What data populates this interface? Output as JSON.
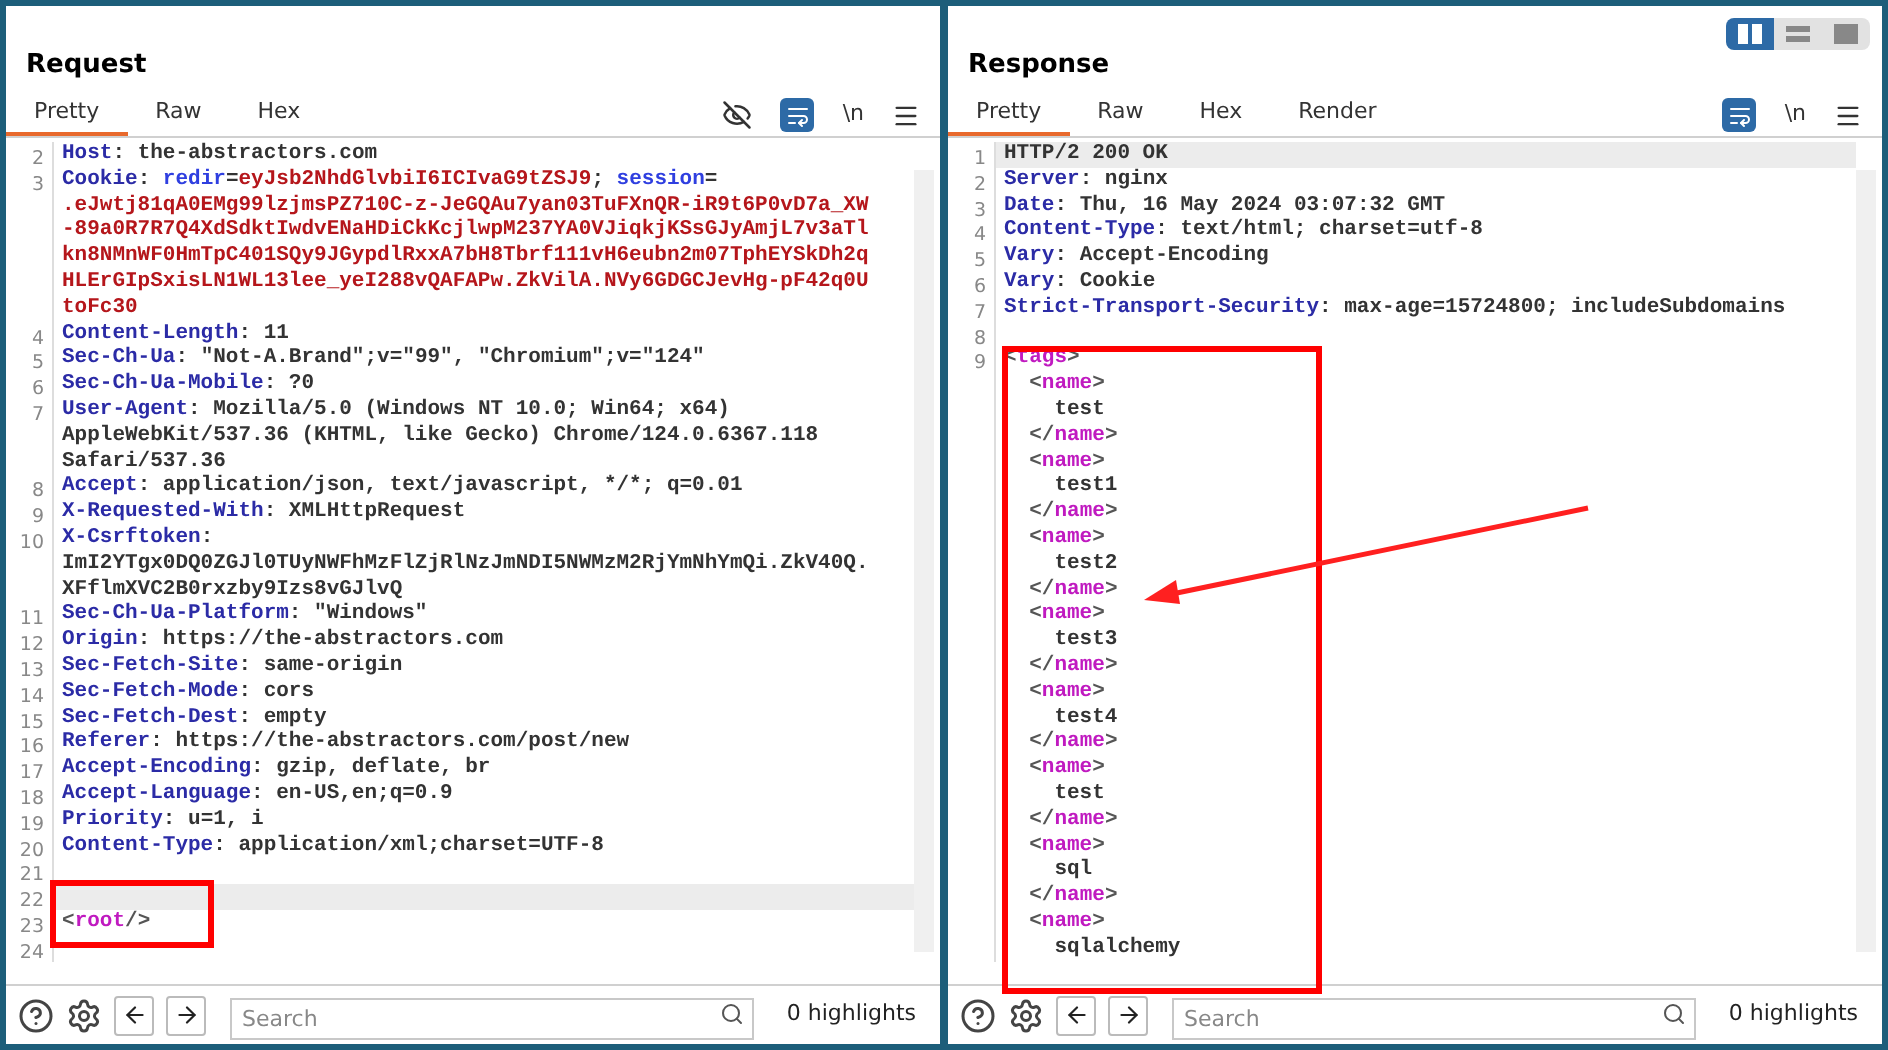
{
  "layout_toggle": [
    {
      "selected": true
    },
    {
      "selected": false
    },
    {
      "selected": false
    }
  ],
  "request": {
    "title": "Request",
    "tabs": [
      {
        "label": "Pretty",
        "selected": true
      },
      {
        "label": "Raw",
        "selected": false
      },
      {
        "label": "Hex",
        "selected": false
      }
    ],
    "hide_toggle": true,
    "newline_label": "\\n",
    "lines": [
      {
        "number": "2",
        "current": false,
        "segments": [
          {
            "kind": "name",
            "text": "Host"
          },
          {
            "kind": "value",
            "text": ": the-abstractors.com"
          }
        ]
      },
      {
        "number": "3",
        "current": false,
        "segments": [
          {
            "kind": "name",
            "text": "Cookie"
          },
          {
            "kind": "value",
            "text": ": "
          },
          {
            "kind": "param",
            "text": "redir"
          },
          {
            "kind": "value",
            "text": "="
          },
          {
            "kind": "secret",
            "text": "eyJsb2NhdGlvbiI6ICIvaG9tZSJ9"
          },
          {
            "kind": "value",
            "text": "; "
          },
          {
            "kind": "param",
            "text": "session"
          },
          {
            "kind": "value",
            "text": "="
          }
        ]
      },
      {
        "current": false,
        "segments": [
          {
            "kind": "secret",
            "text": ".eJwtj81qA0EMg99lzjmsPZ710C-z-JeGQAu7yan03TuFXnQR-iR9t6P0vD7a_XW"
          }
        ]
      },
      {
        "current": false,
        "segments": [
          {
            "kind": "secret",
            "text": "-89a0R7R7Q4XdSdktIwdvENaHDiCkKcjlwpM237YA0VJiqkjKSsGJyAmjL7v3aTl"
          }
        ]
      },
      {
        "current": false,
        "segments": [
          {
            "kind": "secret",
            "text": "kn8NMnWF0HmTpC401SQy9JGypdlRxxA7bH8Tbrf111vH6eubn2m07TphEYSkDh2q"
          }
        ]
      },
      {
        "current": false,
        "segments": [
          {
            "kind": "secret",
            "text": "HLErGIpSxisLN1WL13lee_yeI288vQAFAPw.ZkVilA.NVy6GDGCJevHg-pF42q0U"
          }
        ]
      },
      {
        "current": false,
        "segments": [
          {
            "kind": "secret",
            "text": "toFc30"
          }
        ]
      },
      {
        "number": "4",
        "current": false,
        "segments": [
          {
            "kind": "name",
            "text": "Content-Length"
          },
          {
            "kind": "value",
            "text": ": 11"
          }
        ]
      },
      {
        "number": "5",
        "current": false,
        "segments": [
          {
            "kind": "name",
            "text": "Sec-Ch-Ua"
          },
          {
            "kind": "value",
            "text": ": \"Not-A.Brand\";v=\"99\", \"Chromium\";v=\"124\""
          }
        ]
      },
      {
        "number": "6",
        "current": false,
        "segments": [
          {
            "kind": "name",
            "text": "Sec-Ch-Ua-Mobile"
          },
          {
            "kind": "value",
            "text": ": ?0"
          }
        ]
      },
      {
        "number": "7",
        "current": false,
        "segments": [
          {
            "kind": "name",
            "text": "User-Agent"
          },
          {
            "kind": "value",
            "text": ": Mozilla/5.0 (Windows NT 10.0; Win64; x64)"
          }
        ]
      },
      {
        "current": false,
        "segments": [
          {
            "kind": "value",
            "text": "AppleWebKit/537.36 (KHTML, like Gecko) Chrome/124.0.6367.118"
          }
        ]
      },
      {
        "current": false,
        "segments": [
          {
            "kind": "value",
            "text": "Safari/537.36"
          }
        ]
      },
      {
        "number": "8",
        "current": false,
        "segments": [
          {
            "kind": "name",
            "text": "Accept"
          },
          {
            "kind": "value",
            "text": ": application/json, text/javascript, */*; q=0.01"
          }
        ]
      },
      {
        "number": "9",
        "current": false,
        "segments": [
          {
            "kind": "name",
            "text": "X-Requested-With"
          },
          {
            "kind": "value",
            "text": ": XMLHttpRequest"
          }
        ]
      },
      {
        "number": "10",
        "current": false,
        "segments": [
          {
            "kind": "name",
            "text": "X-Csrftoken"
          },
          {
            "kind": "value",
            "text": ":"
          }
        ]
      },
      {
        "current": false,
        "segments": [
          {
            "kind": "value",
            "text": "ImI2YTgx0DQ0ZGJl0TUyNWFhMzFlZjRlNzJmNDI5NWMzM2RjYmNhYmQi.ZkV40Q."
          }
        ]
      },
      {
        "current": false,
        "segments": [
          {
            "kind": "value",
            "text": "XFflmXVC2B0rxzby9Izs8vGJlvQ"
          }
        ]
      },
      {
        "number": "11",
        "current": false,
        "segments": [
          {
            "kind": "name",
            "text": "Sec-Ch-Ua-Platform"
          },
          {
            "kind": "value",
            "text": ": \"Windows\""
          }
        ]
      },
      {
        "number": "12",
        "current": false,
        "segments": [
          {
            "kind": "name",
            "text": "Origin"
          },
          {
            "kind": "value",
            "text": ": https://the-abstractors.com"
          }
        ]
      },
      {
        "number": "13",
        "current": false,
        "segments": [
          {
            "kind": "name",
            "text": "Sec-Fetch-Site"
          },
          {
            "kind": "value",
            "text": ": same-origin"
          }
        ]
      },
      {
        "number": "14",
        "current": false,
        "segments": [
          {
            "kind": "name",
            "text": "Sec-Fetch-Mode"
          },
          {
            "kind": "value",
            "text": ": cors"
          }
        ]
      },
      {
        "number": "15",
        "current": false,
        "segments": [
          {
            "kind": "name",
            "text": "Sec-Fetch-Dest"
          },
          {
            "kind": "value",
            "text": ": empty"
          }
        ]
      },
      {
        "number": "16",
        "current": false,
        "segments": [
          {
            "kind": "name",
            "text": "Referer"
          },
          {
            "kind": "value",
            "text": ": https://the-abstractors.com/post/new"
          }
        ]
      },
      {
        "number": "17",
        "current": false,
        "segments": [
          {
            "kind": "name",
            "text": "Accept-Encoding"
          },
          {
            "kind": "value",
            "text": ": gzip, deflate, br"
          }
        ]
      },
      {
        "number": "18",
        "current": false,
        "segments": [
          {
            "kind": "name",
            "text": "Accept-Language"
          },
          {
            "kind": "value",
            "text": ": en-US,en;q=0.9"
          }
        ]
      },
      {
        "number": "19",
        "current": false,
        "segments": [
          {
            "kind": "name",
            "text": "Priority"
          },
          {
            "kind": "value",
            "text": ": u=1, i"
          }
        ]
      },
      {
        "number": "20",
        "current": false,
        "segments": [
          {
            "kind": "name",
            "text": "Content-Type"
          },
          {
            "kind": "value",
            "text": ": application/xml;charset=UTF-8"
          }
        ]
      },
      {
        "number": "21",
        "current": false
      },
      {
        "number": "22",
        "current": true
      },
      {
        "number": "23",
        "current": false,
        "segments": [
          {
            "kind": "punct",
            "text": "<"
          },
          {
            "kind": "tag",
            "text": "root"
          },
          {
            "kind": "punct",
            "text": "/>"
          }
        ]
      },
      {
        "number": "24",
        "current": false
      }
    ],
    "search": {
      "placeholder": "Search"
    },
    "highlights": "0 highlights"
  },
  "response": {
    "title": "Response",
    "tabs": [
      {
        "label": "Pretty",
        "selected": true
      },
      {
        "label": "Raw",
        "selected": false
      },
      {
        "label": "Hex",
        "selected": false
      },
      {
        "label": "Render",
        "selected": false
      }
    ],
    "newline_label": "\\n",
    "lines": [
      {
        "number": "1",
        "current": true,
        "segments": [
          {
            "kind": "value",
            "text": "HTTP/2 200 OK"
          }
        ]
      },
      {
        "number": "2",
        "current": false,
        "segments": [
          {
            "kind": "name",
            "text": "Server"
          },
          {
            "kind": "value",
            "text": ": nginx"
          }
        ]
      },
      {
        "number": "3",
        "current": false,
        "segments": [
          {
            "kind": "name",
            "text": "Date"
          },
          {
            "kind": "value",
            "text": ": Thu, 16 May 2024 03:07:32 GMT"
          }
        ]
      },
      {
        "number": "4",
        "current": false,
        "segments": [
          {
            "kind": "name",
            "text": "Content-Type"
          },
          {
            "kind": "value",
            "text": ": text/html; charset=utf-8"
          }
        ]
      },
      {
        "number": "5",
        "current": false,
        "segments": [
          {
            "kind": "name",
            "text": "Vary"
          },
          {
            "kind": "value",
            "text": ": Accept-Encoding"
          }
        ]
      },
      {
        "number": "6",
        "current": false,
        "segments": [
          {
            "kind": "name",
            "text": "Vary"
          },
          {
            "kind": "value",
            "text": ": Cookie"
          }
        ]
      },
      {
        "number": "7",
        "current": false,
        "segments": [
          {
            "kind": "name",
            "text": "Strict-Transport-Security"
          },
          {
            "kind": "value",
            "text": ": max-age=15724800; includeSubdomains"
          }
        ]
      },
      {
        "number": "8",
        "current": false
      },
      {
        "number": "9",
        "current": false,
        "segments": [
          {
            "kind": "punct",
            "text": "<"
          },
          {
            "kind": "tag",
            "text": "tags"
          },
          {
            "kind": "punct",
            "text": ">"
          }
        ]
      },
      {
        "current": false,
        "segments": [
          {
            "kind": "punct",
            "text": "  <"
          },
          {
            "kind": "tag",
            "text": "name"
          },
          {
            "kind": "punct",
            "text": ">"
          }
        ]
      },
      {
        "current": false,
        "segments": [
          {
            "kind": "value",
            "text": "    test"
          }
        ]
      },
      {
        "current": false,
        "segments": [
          {
            "kind": "punct",
            "text": "  </"
          },
          {
            "kind": "tag",
            "text": "name"
          },
          {
            "kind": "punct",
            "text": ">"
          }
        ]
      },
      {
        "current": false,
        "segments": [
          {
            "kind": "punct",
            "text": "  <"
          },
          {
            "kind": "tag",
            "text": "name"
          },
          {
            "kind": "punct",
            "text": ">"
          }
        ]
      },
      {
        "current": false,
        "segments": [
          {
            "kind": "value",
            "text": "    test1"
          }
        ]
      },
      {
        "current": false,
        "segments": [
          {
            "kind": "punct",
            "text": "  </"
          },
          {
            "kind": "tag",
            "text": "name"
          },
          {
            "kind": "punct",
            "text": ">"
          }
        ]
      },
      {
        "current": false,
        "segments": [
          {
            "kind": "punct",
            "text": "  <"
          },
          {
            "kind": "tag",
            "text": "name"
          },
          {
            "kind": "punct",
            "text": ">"
          }
        ]
      },
      {
        "current": false,
        "segments": [
          {
            "kind": "value",
            "text": "    test2"
          }
        ]
      },
      {
        "current": false,
        "segments": [
          {
            "kind": "punct",
            "text": "  </"
          },
          {
            "kind": "tag",
            "text": "name"
          },
          {
            "kind": "punct",
            "text": ">"
          }
        ]
      },
      {
        "current": false,
        "segments": [
          {
            "kind": "punct",
            "text": "  <"
          },
          {
            "kind": "tag",
            "text": "name"
          },
          {
            "kind": "punct",
            "text": ">"
          }
        ]
      },
      {
        "current": false,
        "segments": [
          {
            "kind": "value",
            "text": "    test3"
          }
        ]
      },
      {
        "current": false,
        "segments": [
          {
            "kind": "punct",
            "text": "  </"
          },
          {
            "kind": "tag",
            "text": "name"
          },
          {
            "kind": "punct",
            "text": ">"
          }
        ]
      },
      {
        "current": false,
        "segments": [
          {
            "kind": "punct",
            "text": "  <"
          },
          {
            "kind": "tag",
            "text": "name"
          },
          {
            "kind": "punct",
            "text": ">"
          }
        ]
      },
      {
        "current": false,
        "segments": [
          {
            "kind": "value",
            "text": "    test4"
          }
        ]
      },
      {
        "current": false,
        "segments": [
          {
            "kind": "punct",
            "text": "  </"
          },
          {
            "kind": "tag",
            "text": "name"
          },
          {
            "kind": "punct",
            "text": ">"
          }
        ]
      },
      {
        "current": false,
        "segments": [
          {
            "kind": "punct",
            "text": "  <"
          },
          {
            "kind": "tag",
            "text": "name"
          },
          {
            "kind": "punct",
            "text": ">"
          }
        ]
      },
      {
        "current": false,
        "segments": [
          {
            "kind": "value",
            "text": "    test"
          }
        ]
      },
      {
        "current": false,
        "segments": [
          {
            "kind": "punct",
            "text": "  </"
          },
          {
            "kind": "tag",
            "text": "name"
          },
          {
            "kind": "punct",
            "text": ">"
          }
        ]
      },
      {
        "current": false,
        "segments": [
          {
            "kind": "punct",
            "text": "  <"
          },
          {
            "kind": "tag",
            "text": "name"
          },
          {
            "kind": "punct",
            "text": ">"
          }
        ]
      },
      {
        "current": false,
        "segments": [
          {
            "kind": "value",
            "text": "    sql"
          }
        ]
      },
      {
        "current": false,
        "segments": [
          {
            "kind": "punct",
            "text": "  </"
          },
          {
            "kind": "tag",
            "text": "name"
          },
          {
            "kind": "punct",
            "text": ">"
          }
        ]
      },
      {
        "current": false,
        "segments": [
          {
            "kind": "punct",
            "text": "  <"
          },
          {
            "kind": "tag",
            "text": "name"
          },
          {
            "kind": "punct",
            "text": ">"
          }
        ]
      },
      {
        "current": false,
        "segments": [
          {
            "kind": "value",
            "text": "    sqlalchemy"
          }
        ]
      }
    ],
    "search": {
      "placeholder": "Search"
    },
    "highlights": "0 highlights"
  }
}
